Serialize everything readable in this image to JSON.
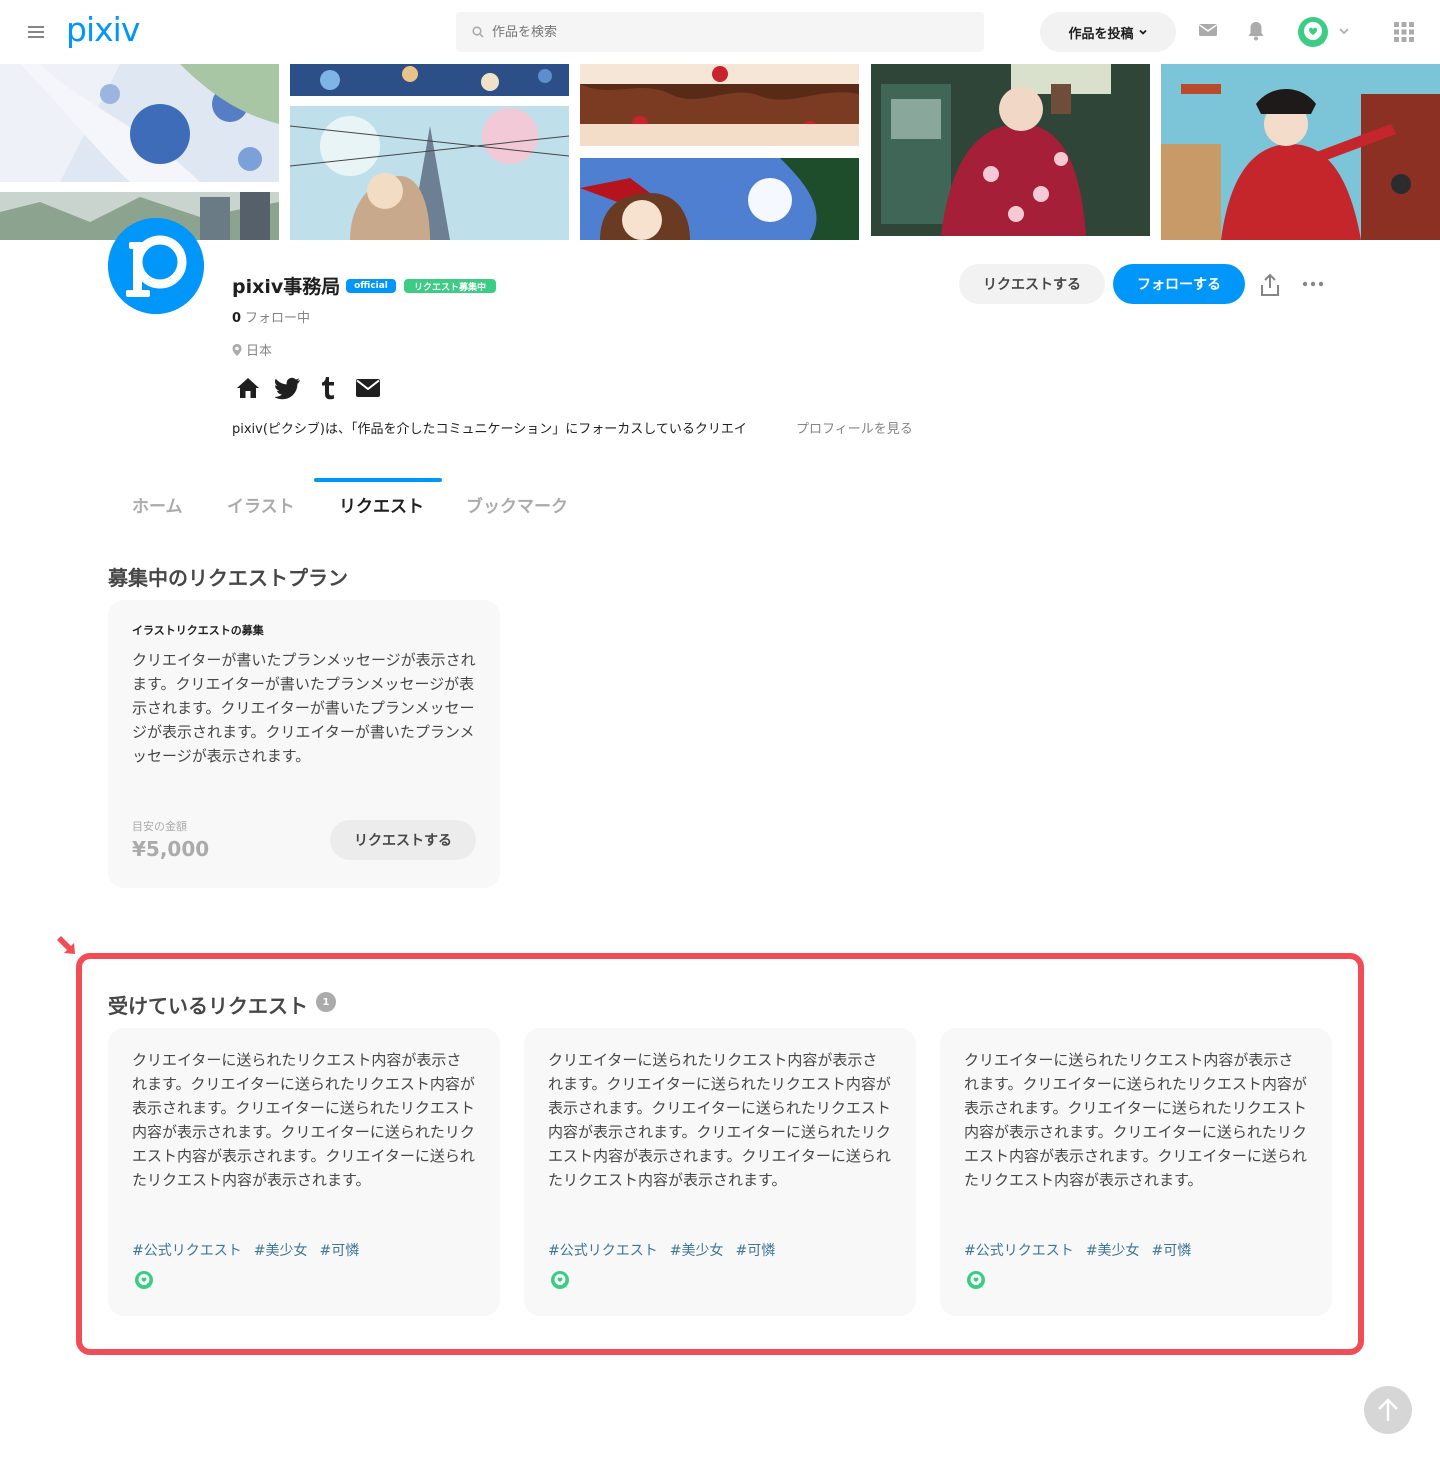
{
  "header": {
    "logo": "pixiv",
    "search_placeholder": "作品を検索",
    "post_label": "作品を投稿",
    "icons": [
      "menu-icon",
      "search-icon",
      "mail-icon",
      "bell-icon",
      "avatar",
      "chevron-down-icon",
      "apps-grid-icon"
    ]
  },
  "profile": {
    "name": "pixiv事務局",
    "badge_official": "official",
    "badge_request": "リクエスト募集中",
    "following_count": "0",
    "following_label": "フォロー中",
    "location": "日本",
    "social_icons": [
      "home-icon",
      "twitter-icon",
      "tumblr-icon",
      "mail-icon"
    ],
    "bio": "pixiv(ピクシブ)は、「作品を介したコミュニケーション」にフォーカスしているクリエイ",
    "bio_link": "プロフィールを見る",
    "request_button": "リクエストする",
    "follow_button": "フォローする"
  },
  "tabs": [
    {
      "label": "ホーム",
      "active": false
    },
    {
      "label": "イラスト",
      "active": false
    },
    {
      "label": "リクエスト",
      "active": true
    },
    {
      "label": "ブックマーク",
      "active": false
    }
  ],
  "plans": {
    "section_title": "募集中のリクエストプラン",
    "card": {
      "title": "イラストリクエストの募集",
      "message": "クリエイターが書いたプランメッセージが表示されます。クリエイターが書いたプランメッセージが表示されます。クリエイターが書いたプランメッセージが表示されます。クリエイターが書いたプランメッセージが表示されます。",
      "price_label": "目安の金額",
      "price": "¥5,000",
      "button": "リクエストする"
    }
  },
  "received": {
    "section_title": "受けているリクエスト",
    "count": "1",
    "cards": [
      {
        "text": "クリエイターに送られたリクエスト内容が表示されます。クリエイターに送られたリクエスト内容が表示されます。クリエイターに送られたリクエスト内容が表示されます。クリエイターに送られたリクエスト内容が表示されます。クリエイターに送られたリクエスト内容が表示されます。",
        "tags": [
          "#公式リクエスト",
          "#美少女",
          "#可憐"
        ]
      },
      {
        "text": "クリエイターに送られたリクエスト内容が表示されます。クリエイターに送られたリクエスト内容が表示されます。クリエイターに送られたリクエスト内容が表示されます。クリエイターに送られたリクエスト内容が表示されます。クリエイターに送られたリクエスト内容が表示されます。",
        "tags": [
          "#公式リクエスト",
          "#美少女",
          "#可憐"
        ]
      },
      {
        "text": "クリエイターに送られたリクエスト内容が表示されます。クリエイターに送られたリクエスト内容が表示されます。クリエイターに送られたリクエスト内容が表示されます。クリエイターに送られたリクエスト内容が表示されます。クリエイターに送られたリクエスト内容が表示されます。",
        "tags": [
          "#公式リクエスト",
          "#美少女",
          "#可憐"
        ]
      }
    ]
  },
  "colors": {
    "accent": "#0096fa",
    "request_badge": "#3ccc86",
    "highlight": "#f24d56",
    "tag": "#3d7699"
  }
}
